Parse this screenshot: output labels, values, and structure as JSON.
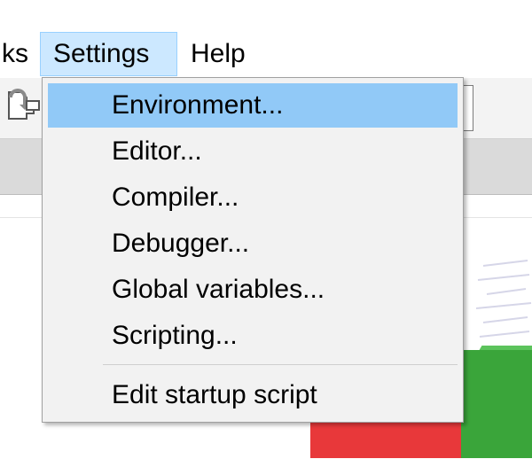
{
  "menubar": {
    "items": [
      {
        "label": "ks"
      },
      {
        "label": "Settings",
        "state": "open"
      },
      {
        "label": "Help"
      }
    ]
  },
  "settings_menu": {
    "items": [
      {
        "label": "Environment...",
        "highlighted": true
      },
      {
        "label": "Editor..."
      },
      {
        "label": "Compiler..."
      },
      {
        "label": "Debugger..."
      },
      {
        "label": "Global variables..."
      },
      {
        "label": "Scripting..."
      },
      {
        "label": "Edit startup script"
      }
    ]
  },
  "colors": {
    "menubar_active_bg": "#cce8ff",
    "menu_highlight": "#91c9f7",
    "menu_bg": "#f2f2f2"
  },
  "icons": {
    "toolbar_first": "run-to-cursor-icon",
    "toolbar_combo": "toolbar-combo-box"
  }
}
